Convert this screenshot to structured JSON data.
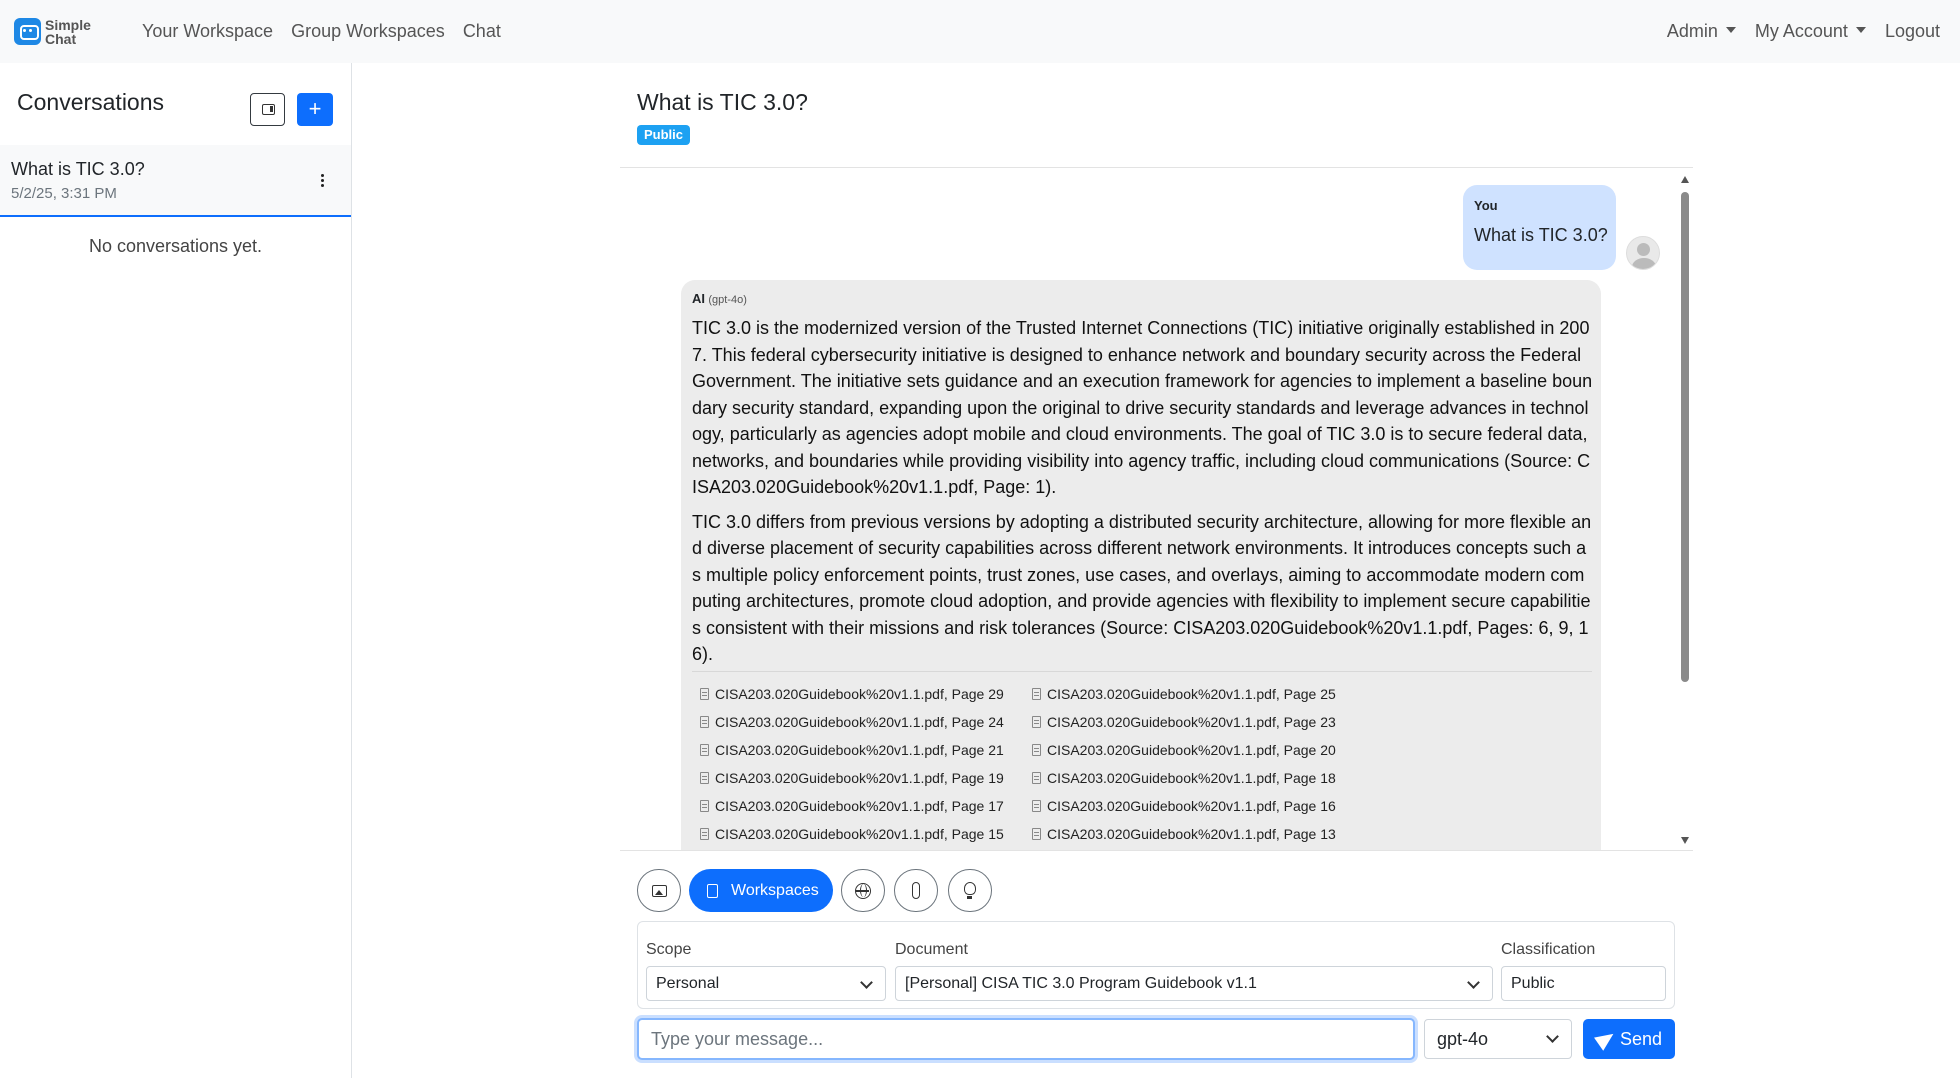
{
  "brand": {
    "line1": "Simple",
    "line2": "Chat"
  },
  "nav": {
    "links": [
      "Your Workspace",
      "Group Workspaces",
      "Chat"
    ],
    "admin": "Admin",
    "account": "My Account",
    "logout": "Logout"
  },
  "sidebar": {
    "title": "Conversations",
    "new_label": "+",
    "conversation": {
      "title": "What is TIC 3.0?",
      "date": "5/2/25, 3:31 PM"
    },
    "empty": "No conversations yet."
  },
  "chat": {
    "title": "What is TIC 3.0?",
    "badge": "Public",
    "user_message": {
      "sender": "You",
      "text": "What is TIC 3.0?"
    },
    "ai_message": {
      "sender": "AI",
      "model": "(gpt-4o)",
      "paragraphs": [
        "TIC 3.0 is the modernized version of the Trusted Internet Connections (TIC) initiative originally established in 2007. This federal cybersecurity initiative is designed to enhance network and boundary security across the Federal Government. The initiative sets guidance and an execution framework for agencies to implement a baseline boundary security standard, expanding upon the original to drive security standards and leverage advances in technology, particularly as agencies adopt mobile and cloud environments. The goal of TIC 3.0 is to secure federal data, networks, and boundaries while providing visibility into agency traffic, including cloud communications (Source: CISA203.020Guidebook%20v1.1.pdf, Page: 1).",
        "TIC 3.0 differs from previous versions by adopting a distributed security architecture, allowing for more flexible and diverse placement of security capabilities across different network environments. It introduces concepts such as multiple policy enforcement points, trust zones, use cases, and overlays, aiming to accommodate modern computing architectures, promote cloud adoption, and provide agencies with flexibility to implement secure capabilities consistent with their missions and risk tolerances (Source: CISA203.020Guidebook%20v1.1.pdf, Pages: 6, 9, 16)."
      ],
      "citations": [
        "CISA203.020Guidebook%20v1.1.pdf, Page 29",
        "CISA203.020Guidebook%20v1.1.pdf, Page 25",
        "CISA203.020Guidebook%20v1.1.pdf, Page 24",
        "CISA203.020Guidebook%20v1.1.pdf, Page 23",
        "CISA203.020Guidebook%20v1.1.pdf, Page 21",
        "CISA203.020Guidebook%20v1.1.pdf, Page 20",
        "CISA203.020Guidebook%20v1.1.pdf, Page 19",
        "CISA203.020Guidebook%20v1.1.pdf, Page 18",
        "CISA203.020Guidebook%20v1.1.pdf, Page 17",
        "CISA203.020Guidebook%20v1.1.pdf, Page 16",
        "CISA203.020Guidebook%20v1.1.pdf, Page 15",
        "CISA203.020Guidebook%20v1.1.pdf, Page 13"
      ]
    }
  },
  "toolbar": {
    "workspaces_label": "Workspaces"
  },
  "options": {
    "scope_label": "Scope",
    "scope_value": "Personal",
    "document_label": "Document",
    "document_value": "[Personal] CISA TIC 3.0 Program Guidebook v1.1",
    "classification_label": "Classification",
    "classification_value": "Public"
  },
  "composer": {
    "placeholder": "Type your message...",
    "model": "gpt-4o",
    "send_label": "Send"
  },
  "colors": {
    "primary": "#0d6efd",
    "badge": "#1da1f2",
    "user_bubble": "#cfe2ff",
    "ai_bubble": "#ececec"
  },
  "icons": [
    "sidebar-toggle-icon",
    "image-icon",
    "document-icon",
    "globe-icon",
    "paperclip-icon",
    "lightbulb-icon",
    "send-icon",
    "kebab-icon"
  ]
}
